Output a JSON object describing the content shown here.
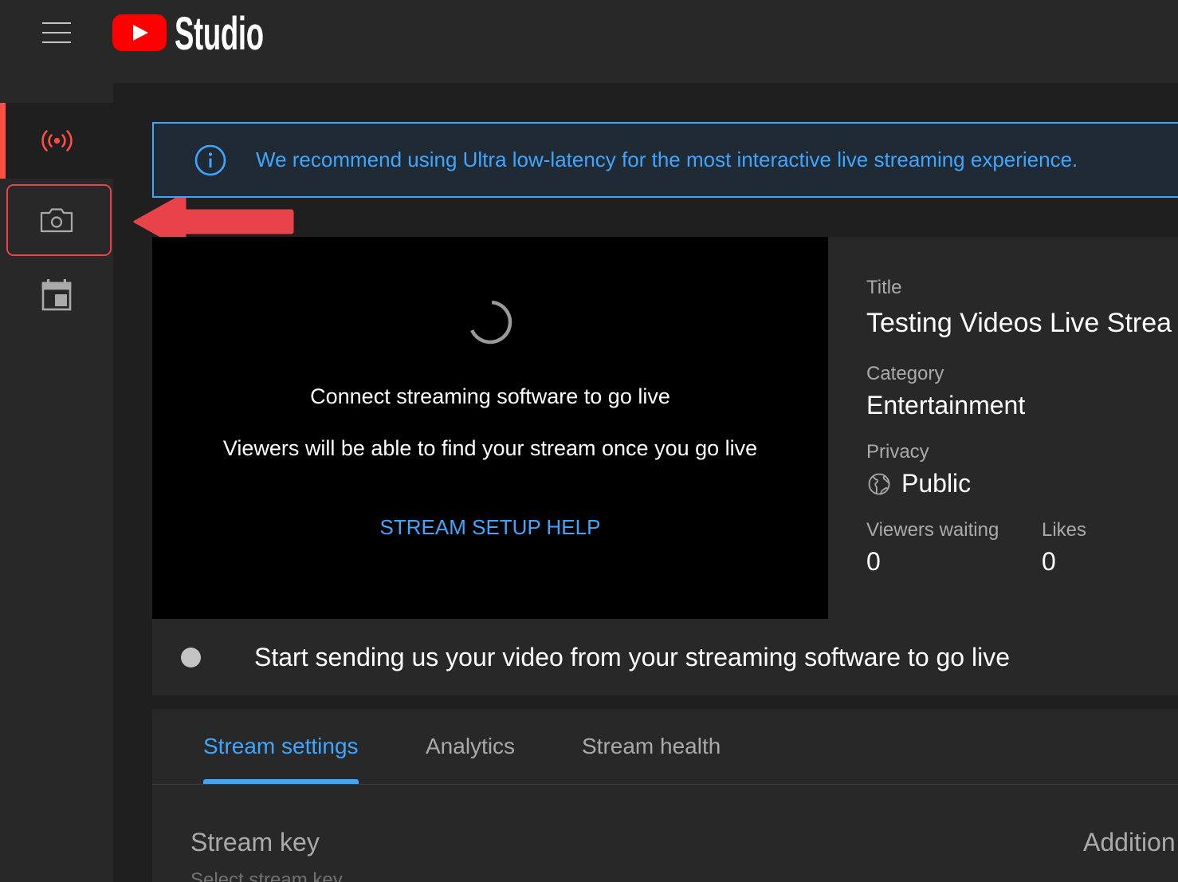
{
  "header": {
    "app_name": "Studio",
    "menu_icon": "hamburger-menu-icon",
    "logo_icon": "youtube-logo-icon"
  },
  "sidebar": {
    "items": [
      {
        "icon": "live-broadcast-icon",
        "active": true
      },
      {
        "icon": "camera-icon",
        "active": false
      },
      {
        "icon": "calendar-icon",
        "active": false
      }
    ]
  },
  "banner": {
    "icon": "info-icon",
    "text": "We recommend using Ultra low-latency for the most interactive live streaming experience."
  },
  "preview": {
    "spinner_icon": "loading-spinner-icon",
    "heading": "Connect streaming software to go live",
    "subtext": "Viewers will be able to find your stream once you go live",
    "help_link": "STREAM SETUP HELP"
  },
  "details": {
    "title_label": "Title",
    "title_value": "Testing Videos Live Strea",
    "category_label": "Category",
    "category_value": "Entertainment",
    "privacy_label": "Privacy",
    "privacy_icon": "globe-icon",
    "privacy_value": "Public",
    "viewers_waiting_label": "Viewers waiting",
    "viewers_waiting_value": "0",
    "likes_label": "Likes",
    "likes_value": "0"
  },
  "status": {
    "indicator_icon": "status-dot-icon",
    "text": "Start sending us your video from your streaming software to go live"
  },
  "tabs": [
    {
      "label": "Stream settings",
      "active": true
    },
    {
      "label": "Analytics",
      "active": false
    },
    {
      "label": "Stream health",
      "active": false
    }
  ],
  "stream_settings": {
    "heading": "Stream key",
    "select_label": "Select stream key",
    "side_heading": "Addition"
  },
  "colors": {
    "accent_blue": "#3ea6ff",
    "live_red": "#ff4e45",
    "annotation_red": "#e8434a",
    "header_bg": "#282828",
    "page_bg": "#1f1f1f",
    "panel_bg": "#282828",
    "banner_bg": "#1f2a34",
    "muted_text": "#aaaaaa"
  }
}
